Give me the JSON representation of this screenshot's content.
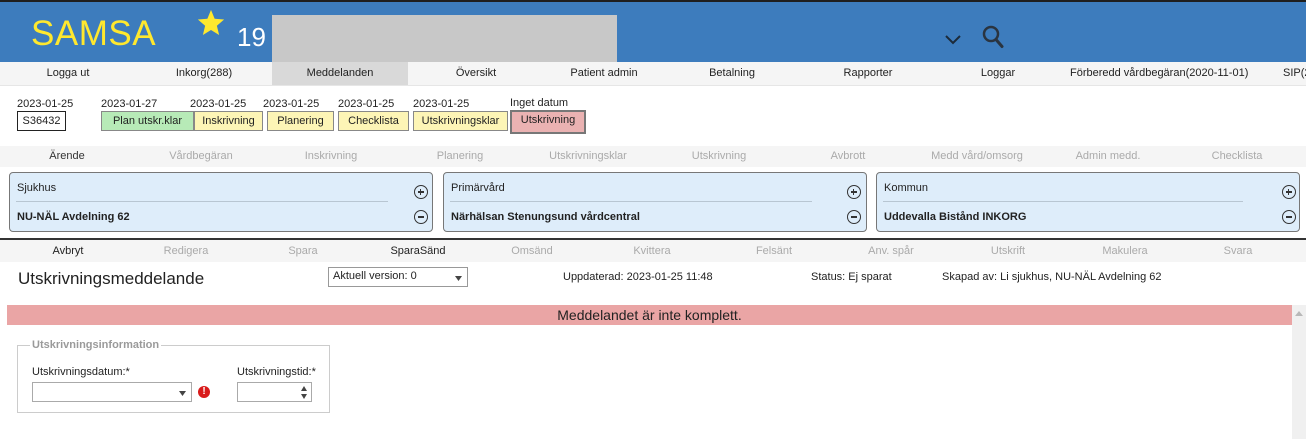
{
  "header": {
    "app_title": "SAMSA",
    "star_count": "19",
    "colors": {
      "bar": "#3d7cbd",
      "title": "#ffe82e"
    },
    "icons": [
      "star-icon",
      "chevron-down-icon",
      "search-icon"
    ]
  },
  "menu": {
    "items": [
      {
        "label": "Logga ut"
      },
      {
        "label": "Inkorg(288)"
      },
      {
        "label": "Meddelanden"
      },
      {
        "label": "Översikt"
      },
      {
        "label": "Patient admin"
      },
      {
        "label": "Betalning"
      },
      {
        "label": "Rapporter"
      },
      {
        "label": "Loggar"
      },
      {
        "label": "Förberedd vårdbegäran(2020-11-01)"
      },
      {
        "label": "SIP(2"
      }
    ],
    "active": "Meddelanden"
  },
  "status": {
    "patient_id": "S36432",
    "dates": [
      "2023-01-25",
      "2023-01-27",
      "2023-01-25",
      "2023-01-25",
      "2023-01-25",
      "2023-01-25",
      "Inget datum"
    ],
    "steps": [
      {
        "label": "Plan utskr.klar"
      },
      {
        "label": "Inskrivning"
      },
      {
        "label": "Planering"
      },
      {
        "label": "Checklista"
      },
      {
        "label": "Utskrivningsklar"
      },
      {
        "label": "Utskrivning"
      }
    ]
  },
  "tabs": {
    "items": [
      {
        "label": "Ärende"
      },
      {
        "label": "Vårdbegäran"
      },
      {
        "label": "Inskrivning"
      },
      {
        "label": "Planering"
      },
      {
        "label": "Utskrivningsklar"
      },
      {
        "label": "Utskrivning"
      },
      {
        "label": "Avbrott"
      },
      {
        "label": "Medd vård/omsorg"
      },
      {
        "label": "Admin medd."
      },
      {
        "label": "Checklista"
      }
    ]
  },
  "panels": [
    {
      "title": "Sjukhus",
      "value": "NU-NÄL Avdelning 62"
    },
    {
      "title": "Primärvård",
      "value": "Närhälsan Stenungsund vårdcentral"
    },
    {
      "title": "Kommun",
      "value": "Uddevalla Bistånd INKORG"
    }
  ],
  "actions": {
    "items": [
      {
        "label": "Avbryt"
      },
      {
        "label": "Redigera"
      },
      {
        "label": "Spara"
      },
      {
        "label": "SparaSänd"
      },
      {
        "label": "Omsänd"
      },
      {
        "label": "Kvittera"
      },
      {
        "label": "Felsänt"
      },
      {
        "label": "Anv. spår"
      },
      {
        "label": "Utskrift"
      },
      {
        "label": "Makulera"
      },
      {
        "label": "Svara"
      }
    ]
  },
  "message": {
    "title": "Utskrivningsmeddelande",
    "version": "Aktuell version: 0",
    "updated": "Uppdaterad: 2023-01-25 11:48",
    "status": "Status: Ej sparat",
    "created_by": "Skapad av: Li sjukhus, NU-NÄL Avdelning 62",
    "alert": "Meddelandet är inte komplett."
  },
  "form": {
    "legend": "Utskrivningsinformation",
    "date_label": "Utskrivningsdatum:*",
    "time_label": "Utskrivningstid:*",
    "date_value": "",
    "time_value": "",
    "error_glyph": "!"
  }
}
